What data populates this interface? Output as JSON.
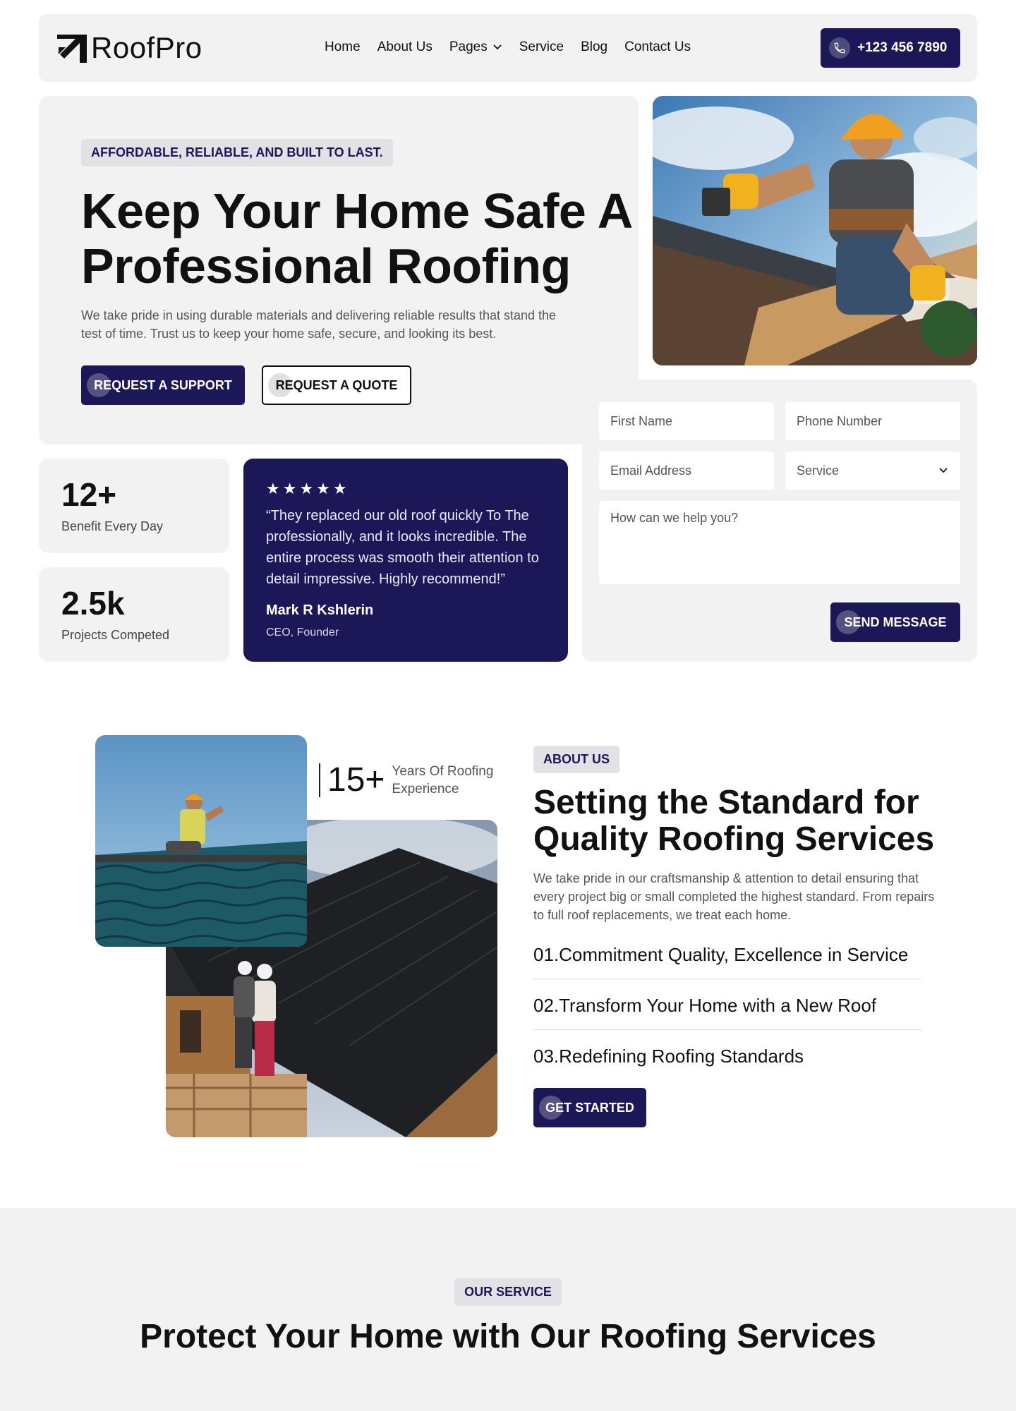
{
  "header": {
    "logo_text": "RoofPro",
    "nav": [
      "Home",
      "About Us",
      "Pages",
      "Service",
      "Blog",
      "Contact Us"
    ],
    "phone": "+123 456 7890"
  },
  "hero": {
    "tag": "AFFORDABLE, RELIABLE, AND BUILT TO LAST.",
    "title": "Keep Your Home Safe A Professional Roofing",
    "text": "We take pride in using durable materials and delivering reliable results that stand the test of time. Trust us to keep your home safe, secure, and looking its best.",
    "btn_support": "REQUEST A SUPPORT",
    "btn_quote": "REQUEST A QUOTE"
  },
  "stats": [
    {
      "value": "12+",
      "label": "Benefit Every Day"
    },
    {
      "value": "2.5k",
      "label": "Projects Competed"
    }
  ],
  "testimonial": {
    "stars": "★★★★★",
    "quote": "“They replaced our old roof quickly To The professionally, and it looks incredible. The entire process was smooth their attention to detail impressive. Highly recommend!”",
    "author": "Mark R Kshlerin",
    "role": "CEO, Founder"
  },
  "form": {
    "first_name": "First Name",
    "phone": "Phone Number",
    "email": "Email Address",
    "service": "Service",
    "message": "How can we help you?",
    "submit": "SEND MESSAGE"
  },
  "about": {
    "years_value": "15+",
    "years_text": "Years Of Roofing Experience",
    "tag": "ABOUT US",
    "title": "Setting the Standard for Quality Roofing Services",
    "text": "We take pride in our craftsmanship & attention to detail ensuring that every project big or small completed the highest standard. From repairs to full roof replacements, we treat each home.",
    "items": [
      "01.Commitment Quality, Excellence in Service",
      "02.Transform Your Home with a New Roof",
      "03.Redefining Roofing Standards"
    ],
    "cta": "GET STARTED"
  },
  "service": {
    "tag": "OUR SERVICE",
    "title": "Protect Your Home with Our Roofing Services"
  },
  "colors": {
    "brand": "#1c1858",
    "panel": "#f2f2f3"
  },
  "icons": [
    "logo-icon",
    "chevron-down-icon",
    "phone-icon",
    "star-icon"
  ]
}
